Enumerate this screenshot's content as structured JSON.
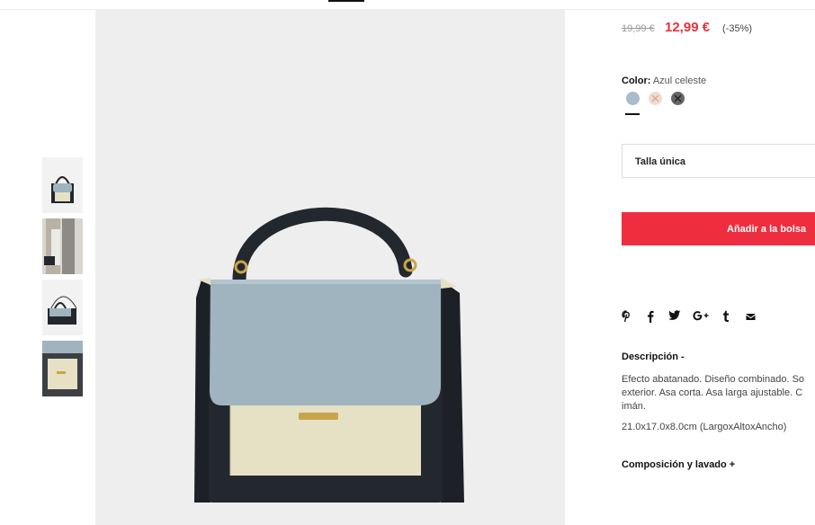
{
  "price": {
    "old": "19,99 €",
    "current": "12,99 €",
    "discount": "(-35%)"
  },
  "color": {
    "label": "Color:",
    "selected": "Azul celeste",
    "swatches": [
      {
        "name": "Azul celeste",
        "hex": "#a9bccb",
        "available": true
      },
      {
        "name": "beige",
        "hex": "#f1dccb",
        "available": false
      },
      {
        "name": "gris",
        "hex": "#666666",
        "available": false
      }
    ]
  },
  "size": {
    "value": "Talla única"
  },
  "cart": {
    "add_label": "Añadir a la bolsa"
  },
  "social": [
    {
      "icon": "pinterest-icon",
      "glyph": "℗"
    },
    {
      "icon": "facebook-icon",
      "glyph": "f"
    },
    {
      "icon": "twitter-icon",
      "glyph": "🐦"
    },
    {
      "icon": "google-plus-icon",
      "glyph": "G+"
    },
    {
      "icon": "tumblr-icon",
      "glyph": "t"
    },
    {
      "icon": "email-icon",
      "glyph": "✉"
    }
  ],
  "description": {
    "title": "Descripción -",
    "text": "Efecto abatanado. Diseño combinado. So exterior. Asa corta. Asa larga ajustable. C imán.",
    "dimensions": "21.0x17.0x8.0cm (LargoxAltoxAncho)"
  },
  "composition": {
    "title": "Composición y lavado +"
  },
  "colors": {
    "accent": "#ee2e3e",
    "price": "#e8313f",
    "bag_dark": "#23272e",
    "bag_blue": "#9fb4bf",
    "bag_cream": "#e6e0c4"
  }
}
